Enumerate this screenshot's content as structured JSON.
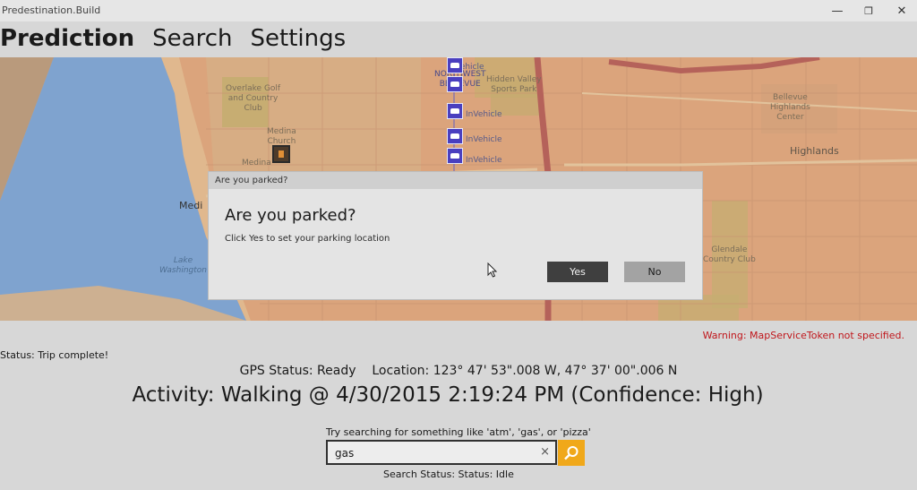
{
  "window": {
    "title": "Predestination.Build",
    "minimize": "—",
    "maximize": "❐",
    "close": "✕"
  },
  "nav": {
    "tabs": [
      {
        "label": "Prediction",
        "active": true
      },
      {
        "label": "Search",
        "active": false
      },
      {
        "label": "Settings",
        "active": false
      }
    ]
  },
  "map": {
    "labels": {
      "overlake": "Overlake Golf\nand Country\nClub",
      "medina_church": "Medina\nChurch",
      "medina_partial": "Medina",
      "medina_city": "Medi",
      "lake": "Lake\nWashington",
      "northwest": "NORTHWEST\nBELLEVUE",
      "hidden_valley": "Hidden Valley\nSports Park",
      "bellevue_highlands": "Bellevue\nHighlands\nCenter",
      "highlands": "Highlands",
      "glendale": "Glendale\nCountry Club",
      "invehicle_1": "InVehicle",
      "invehicle_2": "InVehicle",
      "invehicle_3": "InVehicle",
      "invehicle_top": "InVehicle"
    },
    "poi_icon": "car-icon",
    "parking_icon": "parking-icon"
  },
  "dialog": {
    "title": "Are you parked?",
    "heading": "Are you parked?",
    "text": "Click Yes to set your parking location",
    "yes_label": "Yes",
    "no_label": "No"
  },
  "warning": "Warning: MapServiceToken not specified.",
  "status": "Status: Trip complete!",
  "gps": {
    "status": "GPS Status: Ready",
    "location": "Location: 123° 47' 53\".008 W, 47° 37' 00\".006 N"
  },
  "activity": "Activity: Walking @ 4/30/2015 2:19:24 PM (Confidence: High)",
  "search": {
    "hint": "Try searching for something like 'atm', 'gas', or 'pizza'",
    "value": "gas",
    "clear": "×",
    "button_icon": "search-icon",
    "status": "Search Status:   Status: Idle"
  },
  "colors": {
    "accent": "#f0a81a",
    "warning": "#c0161b",
    "map_land": "#d9a57f",
    "map_water": "#7fa3cf",
    "poi": "#4a3fbf"
  }
}
